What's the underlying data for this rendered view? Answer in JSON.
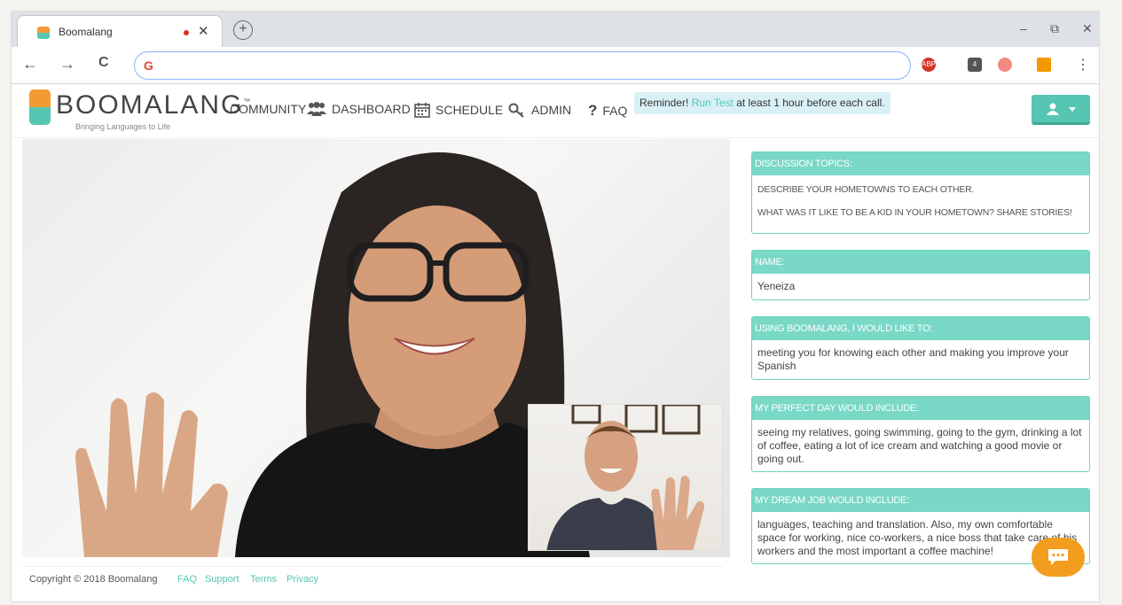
{
  "browser": {
    "tab_title": "Boomalang",
    "tab_close": "✕",
    "new_tab": "+",
    "minimize": "–",
    "restore": "⧉",
    "close": "✕",
    "back": "←",
    "forward": "→",
    "reload": "C",
    "omnibox_value": "",
    "omnibox_icon": "G",
    "menu": "⋮",
    "ext_abp_label": "ABP",
    "ext_key_label": "4"
  },
  "site": {
    "logo_text": "BOOMALANG",
    "logo_tm": "™",
    "tagline": "Bringing Languages to Life",
    "nav": {
      "community": "COMMUNITY",
      "dashboard": "DASHBOARD",
      "schedule": "SCHEDULE",
      "admin": "ADMIN",
      "faq": "FAQ"
    },
    "reminder": {
      "prefix": "Reminder!",
      "link": "Run Test",
      "suffix": "at least 1 hour before each call."
    }
  },
  "profile": {
    "topics_header": "Discussion Topics:",
    "topics": [
      "Describe your hometowns to each other.",
      "What was it like to be a kid in your hometown? Share stories!"
    ],
    "name_header": "Name:",
    "name_value": "Yeneiza",
    "goal_header": "Using Boomalang, I would like to:",
    "goal_value": "meeting you for knowing each other and making you improve your Spanish",
    "day_header": "My perfect day would include:",
    "day_value": "seeing my relatives, going swimming, going to the gym, drinking a lot of coffee, eating a lot of ice cream and watching a good movie or going out.",
    "job_header": "My dream job would include:",
    "job_value": "languages, teaching and translation. Also, my own comfortable space for working, nice co-workers, a nice boss that take care of his workers and the most important a coffee machine!"
  },
  "footer": {
    "copyright": "Copyright © 2018 Boomalang",
    "faq": "FAQ",
    "support": "Support",
    "terms": "Terms",
    "privacy": "Privacy"
  },
  "colors": {
    "brand_teal": "#56c6b2",
    "brand_orange": "#f39a32",
    "card_header": "#79d8c6",
    "chat_button": "#f29d1d"
  }
}
